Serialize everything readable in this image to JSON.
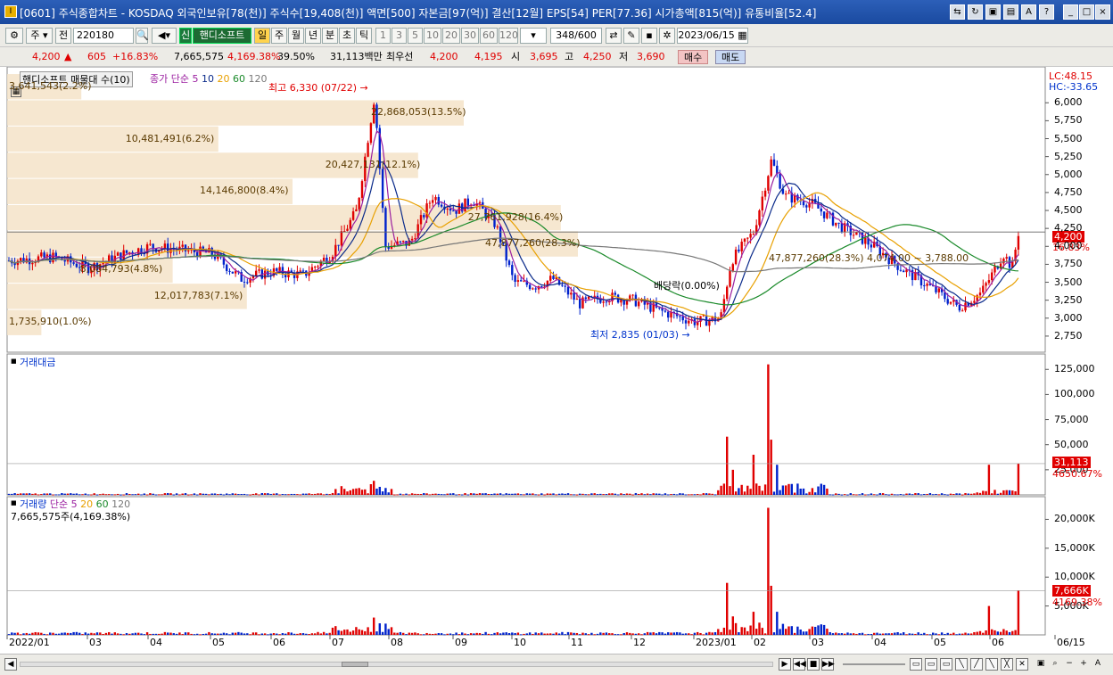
{
  "window": {
    "title": "[0601] 주식종합차트 - KOSDAQ 외국인보유[78(천)] 주식수[19,408(천)] 액면[500] 자본금[97(억)] 결산[12월] EPS[54] PER[77.36] 시가총액[815(억)] 유통비율[52.4]",
    "app_icon": "I"
  },
  "toolbar": {
    "period": "주",
    "prev_label": "전",
    "code": "220180",
    "name": "핸디소프트",
    "new_badge": "신",
    "period_buttons": [
      "일",
      "주",
      "월",
      "년",
      "분",
      "초",
      "틱"
    ],
    "active_period": "일",
    "intervals": [
      "1",
      "3",
      "5",
      "10",
      "20",
      "30",
      "60",
      "120"
    ],
    "count": "348",
    "count_total": "/600",
    "date": "2023/06/15"
  },
  "quote": {
    "price": "4,200",
    "updown": "▲",
    "change": "605",
    "change_pct": "+16.83%",
    "volume": "7,665,575",
    "vol_pct": "4,169.38%",
    "vol_ratio": "39.50%",
    "amount": "31,113백만",
    "best_label": "최우선",
    "ask": "4,200",
    "bid": "4,195",
    "open_label": "시",
    "open": "3,695",
    "high_label": "고",
    "high": "4,250",
    "low_label": "저",
    "low": "3,690",
    "buy": "매수",
    "sell": "매도"
  },
  "price_panel": {
    "volume_profile_title": "핸디소프트 매물대 수(10)",
    "ma_title": "종가 단순",
    "ma_periods": [
      "5",
      "10",
      "20",
      "60",
      "120"
    ],
    "lc": "LC:48.15",
    "hc": "HC:-33.65",
    "high_note": "최고 6,330 (07/22)",
    "low_note": "최저 2,835 (01/03)",
    "dividend_note": "배당락(0.00%)",
    "range_note": "47,877,260(28.3%) 4,074.00 ~ 3,788.00",
    "last_price": "4,200",
    "last_pct": "16.83%",
    "y_ticks": [
      "6,000",
      "5,750",
      "5,500",
      "5,250",
      "5,000",
      "4,750",
      "4,500",
      "4,250",
      "4,000",
      "3,750",
      "3,500",
      "3,250",
      "3,000",
      "2,750"
    ],
    "profile": [
      {
        "label": "3,641,543(2.2%)",
        "w": 0.13
      },
      {
        "label": "22,868,053(13.5%)",
        "w": 0.8
      },
      {
        "label": "10,481,491(6.2%)",
        "w": 0.37
      },
      {
        "label": "20,427,131(12.1%)",
        "w": 0.72
      },
      {
        "label": "14,146,800(8.4%)",
        "w": 0.5
      },
      {
        "label": "27,761,928(16.4%)",
        "w": 0.97
      },
      {
        "label": "47,877,260(28.3%)",
        "w": 1.0
      },
      {
        "label": "8,084,793(4.8%)",
        "w": 0.29
      },
      {
        "label": "12,017,783(7.1%)",
        "w": 0.42
      },
      {
        "label": "1,735,910(1.0%)",
        "w": 0.06
      }
    ]
  },
  "amount_panel": {
    "title": "거래대금",
    "y_ticks": [
      "125,000",
      "100,000",
      "75,000",
      "50,000",
      "25,000"
    ],
    "last": "31,113",
    "last2": "4650.67%"
  },
  "volume_panel": {
    "title": "거래량",
    "ma_title": "단순",
    "ma_periods": [
      "5",
      "20",
      "60",
      "120"
    ],
    "current": "7,665,575주(4,169.38%)",
    "y_ticks": [
      "20,000K",
      "15,000K",
      "10,000K",
      "5,000K"
    ],
    "last": "7,666K",
    "last2": "4169.38%"
  },
  "x_axis": [
    "2022/01",
    "03",
    "04",
    "05",
    "06",
    "07",
    "08",
    "09",
    "10",
    "11",
    "12",
    "2023/01",
    "02",
    "03",
    "04",
    "05",
    "06",
    "06/15"
  ],
  "colors": {
    "up": "#e00000",
    "down": "#0022cc",
    "ma5": "#9b1fa0",
    "ma10": "#0a2a8a",
    "ma20": "#e8a000",
    "ma60": "#1a8a2a",
    "ma120": "#777777",
    "profile": "#f5e3c8"
  }
}
